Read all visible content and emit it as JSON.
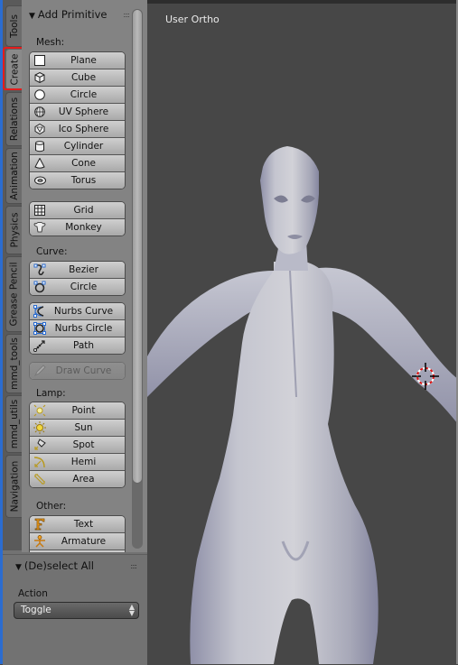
{
  "toolshelf": {
    "tabs": [
      {
        "label": "Tools",
        "active": false
      },
      {
        "label": "Create",
        "active": true
      },
      {
        "label": "Relations",
        "active": false
      },
      {
        "label": "Animation",
        "active": false
      },
      {
        "label": "Physics",
        "active": false
      },
      {
        "label": "Grease Pencil",
        "active": false
      },
      {
        "label": "mmd_tools",
        "active": false
      },
      {
        "label": "mmd_utils",
        "active": false
      },
      {
        "label": "Navigation",
        "active": false
      }
    ],
    "panel_title": "Add Primitive",
    "sections": {
      "mesh": {
        "label": "Mesh:",
        "group1": [
          {
            "label": "Plane",
            "icon": "plane-icon"
          },
          {
            "label": "Cube",
            "icon": "cube-icon"
          },
          {
            "label": "Circle",
            "icon": "circle-icon"
          },
          {
            "label": "UV Sphere",
            "icon": "uv-sphere-icon"
          },
          {
            "label": "Ico Sphere",
            "icon": "ico-sphere-icon"
          },
          {
            "label": "Cylinder",
            "icon": "cylinder-icon"
          },
          {
            "label": "Cone",
            "icon": "cone-icon"
          },
          {
            "label": "Torus",
            "icon": "torus-icon"
          }
        ],
        "group2": [
          {
            "label": "Grid",
            "icon": "grid-icon"
          },
          {
            "label": "Monkey",
            "icon": "monkey-icon"
          }
        ]
      },
      "curve": {
        "label": "Curve:",
        "group1": [
          {
            "label": "Bezier",
            "icon": "bezier-curve-icon"
          },
          {
            "label": "Circle",
            "icon": "bezier-circle-icon"
          }
        ],
        "group2": [
          {
            "label": "Nurbs Curve",
            "icon": "nurbs-curve-icon"
          },
          {
            "label": "Nurbs Circle",
            "icon": "nurbs-circle-icon"
          },
          {
            "label": "Path",
            "icon": "path-icon"
          }
        ],
        "draw_curve": {
          "label": "Draw Curve",
          "icon": "pencil-icon",
          "disabled": true
        }
      },
      "lamp": {
        "label": "Lamp:",
        "items": [
          {
            "label": "Point",
            "icon": "point-lamp-icon"
          },
          {
            "label": "Sun",
            "icon": "sun-lamp-icon"
          },
          {
            "label": "Spot",
            "icon": "spot-lamp-icon"
          },
          {
            "label": "Hemi",
            "icon": "hemi-lamp-icon"
          },
          {
            "label": "Area",
            "icon": "area-lamp-icon"
          }
        ]
      },
      "other": {
        "label": "Other:",
        "items": [
          {
            "label": "Text",
            "icon": "text-icon"
          },
          {
            "label": "Armature",
            "icon": "armature-icon"
          }
        ]
      }
    }
  },
  "operator_panel": {
    "title": "(De)select All",
    "action_label": "Action",
    "action_value": "Toggle"
  },
  "viewport": {
    "view_label": "User Ortho"
  },
  "colors": {
    "highlight_outline": "#e51c1c",
    "lamp_icon": "#e8c840",
    "curve_handle": "#2b6cd0"
  }
}
